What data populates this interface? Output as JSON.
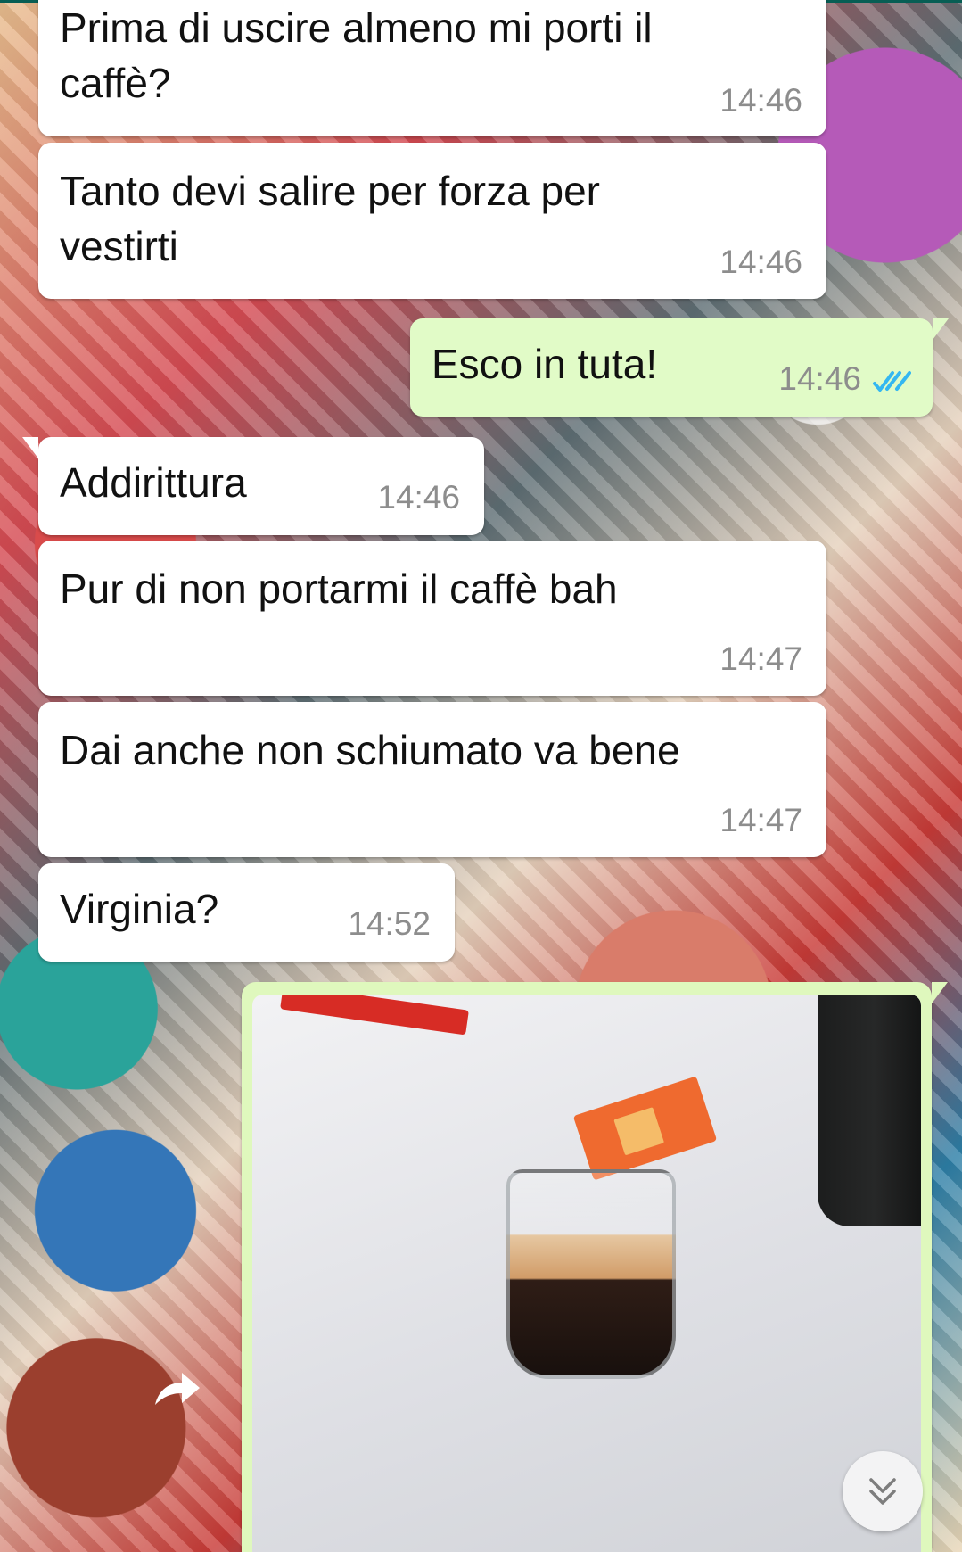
{
  "chat": {
    "messages": [
      {
        "text": "Prima di uscire almeno mi porti il\ncaffè?",
        "time": "14:46",
        "direction": "incoming"
      },
      {
        "text": "Tanto devi salire per forza per\nvestirti",
        "time": "14:46",
        "direction": "incoming"
      },
      {
        "text": "Esco in tuta!",
        "time": "14:46",
        "direction": "outgoing",
        "status_icon": "double-check-icon"
      },
      {
        "text": "Addirittura",
        "time": "14:46",
        "direction": "incoming"
      },
      {
        "text": "Pur di non portarmi il caffè bah",
        "time": "14:47",
        "direction": "incoming"
      },
      {
        "text": "Dai anche non schiumato va bene",
        "time": "14:47",
        "direction": "incoming"
      },
      {
        "text": "Virginia?",
        "time": "14:52",
        "direction": "incoming"
      }
    ],
    "photo_message": {
      "direction": "outgoing",
      "image_subject": "espresso glass on white table"
    }
  },
  "icons": {
    "read_receipt": "double-check-icon",
    "forward": "forward-arrow-icon",
    "scroll_down": "double-chevron-down-icon"
  },
  "colors": {
    "incoming_bubble": "#ffffff",
    "outgoing_bubble": "#e1fbc7",
    "read_tick": "#34b7f1",
    "timestamp": "#8d8d8d"
  }
}
